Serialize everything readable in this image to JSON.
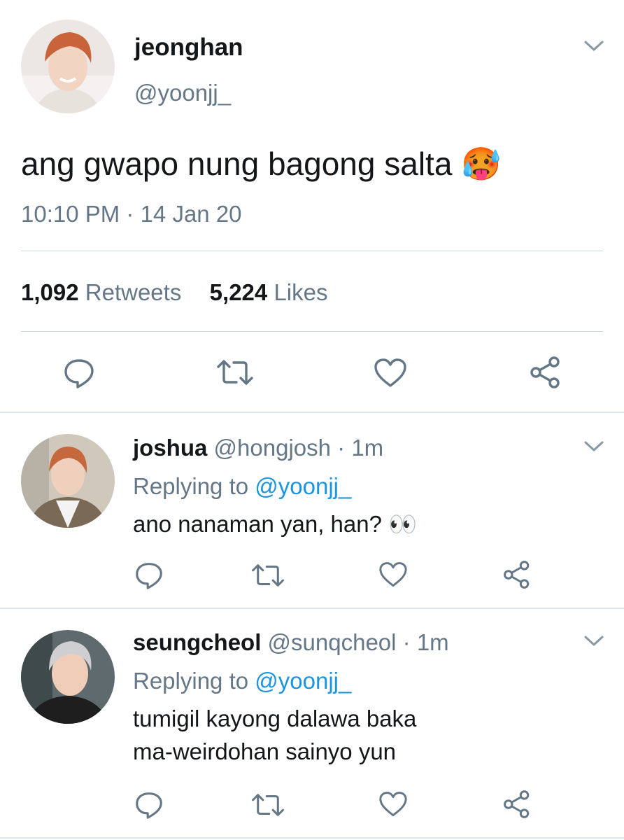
{
  "main_tweet": {
    "display_name": "jeonghan",
    "handle": "@yoonjj_",
    "text": "ang gwapo nung bagong salta",
    "emoji": "🥵",
    "timestamp": "10:10 PM · 14 Jan 20",
    "retweet_count": "1,092",
    "retweet_label": "Retweets",
    "like_count": "5,224",
    "like_label": "Likes"
  },
  "replies": [
    {
      "display_name": "joshua",
      "handle": "@hongjosh",
      "time": "· 1m",
      "replying_prefix": "Replying to",
      "replying_handle": "@yoonjj_",
      "text": "ano nanaman yan, han?",
      "emoji": "👀"
    },
    {
      "display_name": "seungcheol",
      "handle": "@sunqcheol",
      "time": "· 1m",
      "replying_prefix": "Replying to",
      "replying_handle": "@yoonjj_",
      "text_line1": "tumigil kayong dalawa baka",
      "text_line2": "ma-weirdohan sainyo yun"
    }
  ],
  "icons": [
    "chevron-down-icon",
    "reply-icon",
    "retweet-icon",
    "like-icon",
    "share-icon"
  ],
  "colors": {
    "text": "#14171a",
    "secondary": "#657786",
    "link": "#1b95e0",
    "divider": "#ccd6dd"
  }
}
